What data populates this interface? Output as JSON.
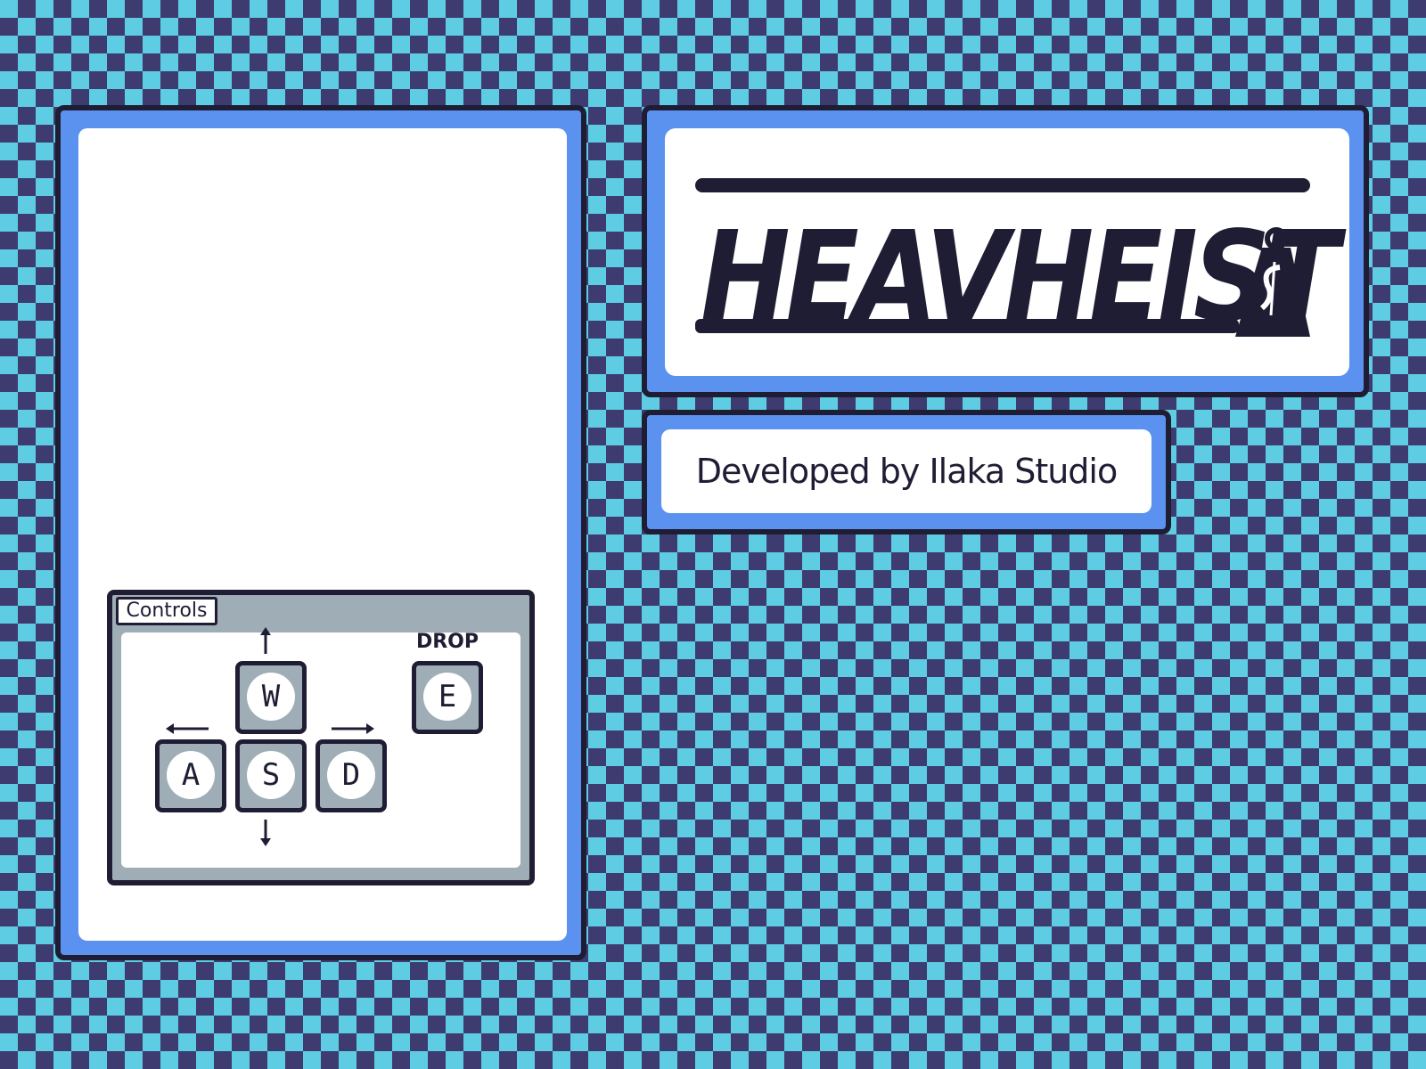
{
  "title": {
    "logo_text": "HEAVHEIST",
    "logo_icon": "money-bag-icon"
  },
  "credit": {
    "text": "Developed by Ilaka Studio"
  },
  "controls": {
    "tab_label": "Controls",
    "keys": {
      "up": "W",
      "left": "A",
      "down": "S",
      "right": "D",
      "drop": "E"
    },
    "drop_label": "DROP"
  },
  "colors": {
    "checker_dark": "#3d3b70",
    "checker_light": "#5ecde3",
    "frame_blue": "#5b92f0",
    "outline": "#1f1d33",
    "key_gray": "#9fadb6"
  }
}
